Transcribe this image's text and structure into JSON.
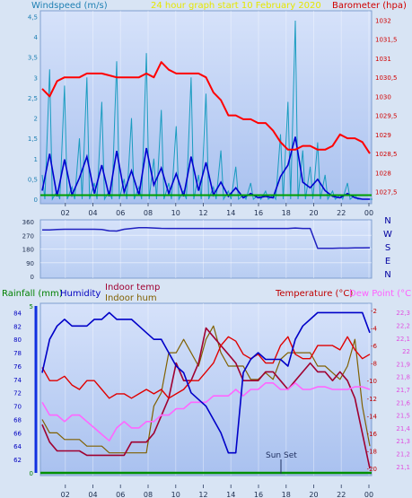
{
  "chart_data": [
    {
      "type": "line",
      "title": "24 hour graph start 10 February 2020",
      "x": [
        "00",
        "02",
        "04",
        "06",
        "08",
        "10",
        "12",
        "14",
        "16",
        "18",
        "20",
        "22",
        "00"
      ],
      "xticks": [
        "02",
        "04",
        "06",
        "08",
        "10",
        "12",
        "14",
        "16",
        "18",
        "20",
        "22",
        "00"
      ],
      "left_axis": {
        "label": "Windspeed (m/s)",
        "ticks": [
          "0",
          "0,5",
          "1",
          "1,5",
          "2",
          "2,5",
          "3",
          "3,5",
          "4",
          "4,5"
        ],
        "range": [
          0,
          4.6
        ]
      },
      "right_axis": {
        "label": "Barometer (hpa)",
        "ticks": [
          "1027,5",
          "1028",
          "1028,5",
          "1029",
          "1029,5",
          "1030",
          "1030,5",
          "1031",
          "1031,5",
          "1032"
        ],
        "range": [
          1027.3,
          1032.2
        ]
      },
      "series": [
        {
          "name": "Barometer (hpa)",
          "axis": "right",
          "color": "#ff0000",
          "values": [
            1030.2,
            1030.0,
            1030.4,
            1030.5,
            1030.5,
            1030.5,
            1030.6,
            1030.6,
            1030.6,
            1030.55,
            1030.5,
            1030.5,
            1030.5,
            1030.5,
            1030.6,
            1030.5,
            1030.9,
            1030.7,
            1030.6,
            1030.6,
            1030.6,
            1030.6,
            1030.5,
            1030.1,
            1029.9,
            1029.5,
            1029.5,
            1029.4,
            1029.4,
            1029.3,
            1029.3,
            1029.1,
            1028.8,
            1028.6,
            1028.6,
            1028.7,
            1028.7,
            1028.6,
            1028.6,
            1028.7,
            1029.0,
            1028.9,
            1028.9,
            1028.8,
            1028.5
          ]
        }
      ]
    },
    {
      "type": "line",
      "title": "",
      "left_axis": {
        "ticks": [
          "0",
          "90",
          "180",
          "270",
          "360"
        ],
        "range": [
          0,
          360
        ]
      },
      "right_axis": {
        "ticks": [
          "N",
          "W",
          "S",
          "E",
          "N"
        ]
      },
      "series": [
        {
          "name": "",
          "color": "#2020c0",
          "values": [
            305,
            305,
            308,
            310,
            310,
            310,
            310,
            310,
            308,
            300,
            298,
            310,
            315,
            320,
            320,
            318,
            316,
            315,
            315,
            315,
            315,
            315,
            315,
            315,
            315,
            315,
            315,
            315,
            315,
            315,
            315,
            315,
            315,
            315,
            318,
            315,
            315,
            185,
            185,
            185,
            186,
            186,
            187,
            187,
            188
          ]
        }
      ]
    },
    {
      "type": "line",
      "title": "",
      "left_axis": {
        "label": "Humidity",
        "ticks": [
          "62",
          "64",
          "66",
          "68",
          "70",
          "72",
          "74",
          "76",
          "78",
          "80",
          "82",
          "84"
        ],
        "range": [
          60,
          85
        ]
      },
      "left_axis_2": {
        "label": "Rainfall (mm)",
        "ticks": [
          "0",
          "5"
        ],
        "range": [
          0,
          5
        ]
      },
      "right_axis": {
        "label": "Temperature (°C)",
        "ticks": [
          "-20",
          "-18",
          "-16",
          "-14",
          "-12",
          "-10",
          "-8",
          "-6",
          "-4",
          "-2"
        ],
        "range": [
          -20.5,
          -1.5
        ]
      },
      "right_axis_2": {
        "label": "Dew Point (°C)",
        "ticks": [
          "21,1",
          "21,2",
          "21,3",
          "21,4",
          "21,5",
          "21,6",
          "21,7",
          "21,8",
          "21,9",
          "22",
          "22,1",
          "22,2",
          "22,3"
        ],
        "range": [
          21.05,
          22.35
        ]
      },
      "legend_extra": [
        "Indoor temp",
        "Indoor hum"
      ],
      "annotations": [
        "Sun Set"
      ],
      "series": [
        {
          "name": "Humidity",
          "color": "#0000c8",
          "values": [
            75,
            80,
            82,
            83,
            82,
            82,
            82,
            83,
            83,
            84,
            83,
            83,
            83,
            82,
            81,
            80,
            80,
            78,
            76,
            75,
            72,
            71,
            70,
            68,
            66,
            63,
            63,
            75,
            77,
            78,
            77,
            77,
            77,
            76,
            80,
            82,
            83,
            84,
            84,
            84,
            84,
            84,
            84,
            84,
            81
          ]
        },
        {
          "name": "Temperature (°C)",
          "color": "#e00000",
          "values": [
            -8.5,
            -10,
            -10,
            -9.5,
            -10.5,
            -11,
            -10,
            -10,
            -11,
            -12,
            -11.5,
            -11.5,
            -12,
            -11.5,
            -11,
            -11.5,
            -11,
            -12,
            -11.5,
            -11,
            -10,
            -10,
            -9,
            -8,
            -6,
            -5,
            -5.5,
            -7,
            -7.5,
            -7,
            -8,
            -8,
            -6,
            -5,
            -7,
            -7.5,
            -7.5,
            -6,
            -6,
            -6,
            -6.5,
            -5,
            -6.5,
            -7.5,
            -7
          ]
        },
        {
          "name": "Dew Point (°C)",
          "color": "#ff66ff",
          "values": [
            21.6,
            21.5,
            21.5,
            21.45,
            21.5,
            21.5,
            21.45,
            21.4,
            21.35,
            21.3,
            21.4,
            21.45,
            21.4,
            21.4,
            21.45,
            21.45,
            21.5,
            21.5,
            21.55,
            21.55,
            21.6,
            21.6,
            21.6,
            21.65,
            21.65,
            21.65,
            21.7,
            21.65,
            21.7,
            21.7,
            21.75,
            21.75,
            21.7,
            21.7,
            21.75,
            21.7,
            21.7,
            21.72,
            21.72,
            21.7,
            21.7,
            21.7,
            21.72,
            21.72,
            21.7
          ]
        },
        {
          "name": "Indoor temp",
          "color": "#a00030",
          "values": [
            -15,
            -17,
            -18,
            -18,
            -18,
            -18,
            -18.5,
            -18.5,
            -18.5,
            -18.5,
            -18.5,
            -18.5,
            -17,
            -17,
            -17,
            -16,
            -14,
            -12,
            -8,
            -10,
            -10,
            -8,
            -4,
            -5,
            -6,
            -7,
            -8,
            -10,
            -10,
            -10,
            -9,
            -9,
            -10,
            -11,
            -10,
            -9,
            -8,
            -9,
            -9,
            -10,
            -9,
            -10,
            -12,
            -16,
            -20
          ]
        },
        {
          "name": "Indoor hum",
          "color": "#806000",
          "values": [
            68,
            66,
            66,
            65,
            65,
            65,
            64,
            64,
            64,
            63,
            63,
            63,
            63,
            63,
            63,
            70,
            72,
            78,
            78,
            80,
            78,
            76,
            80,
            82,
            78,
            76,
            76,
            76,
            74,
            74,
            75,
            74,
            77,
            78,
            78,
            78,
            78,
            76,
            76,
            75,
            74,
            76,
            80,
            70,
            64
          ]
        },
        {
          "name": "Rainfall (mm)",
          "color": "#009000",
          "values": [
            0,
            0,
            0,
            0,
            0,
            0,
            0,
            0,
            0,
            0,
            0,
            0,
            0,
            0,
            0,
            0,
            0,
            0,
            0,
            0,
            0,
            0,
            0,
            0,
            0,
            0,
            0,
            0,
            0,
            0,
            0,
            0,
            0,
            0,
            0,
            0,
            0,
            0,
            0,
            0,
            0,
            0,
            0,
            0,
            0
          ]
        }
      ]
    }
  ]
}
